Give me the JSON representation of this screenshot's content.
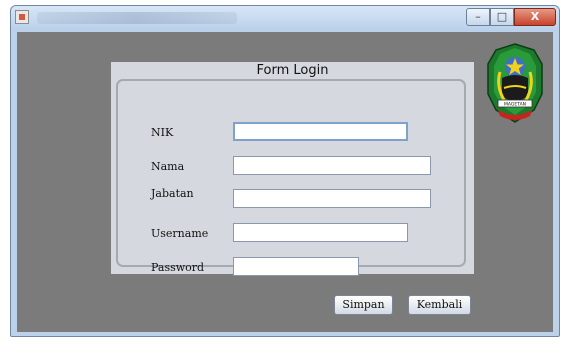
{
  "window": {
    "controls": {
      "minimize": "–",
      "maximize": "□",
      "close": "X"
    }
  },
  "form": {
    "title": "Form Login",
    "fields": [
      {
        "label": "NIK",
        "value": ""
      },
      {
        "label": "Nama",
        "value": ""
      },
      {
        "label": "Jabatan",
        "value": ""
      },
      {
        "label": "Username",
        "value": ""
      },
      {
        "label": "Password",
        "value": ""
      }
    ]
  },
  "buttons": {
    "save": "Simpan",
    "back": "Kembali"
  },
  "logo": {
    "icon": "regency-emblem-icon",
    "banner_text": "MAGETAN"
  },
  "colors": {
    "content_bg": "#7b7b7b",
    "panel_bg": "#d5d9df",
    "titlebar": "#bcd2ea",
    "close_button": "#c8432b"
  }
}
